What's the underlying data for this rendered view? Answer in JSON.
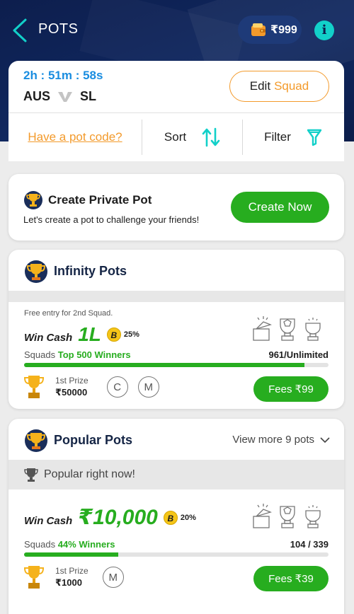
{
  "header": {
    "title": "POTS",
    "wallet_amount": "₹999",
    "info_symbol": "i"
  },
  "match": {
    "timer": "2h : 51m : 58s",
    "team1": "AUS",
    "team2": "SL",
    "edit_label": "Edit",
    "squad_label": "Squad"
  },
  "filters": {
    "pot_code": "Have a pot code?",
    "sort": "Sort",
    "filter": "Filter"
  },
  "private_pot": {
    "title": "Create Private Pot",
    "subtitle": "Let's create a pot to challenge your friends!",
    "button": "Create Now"
  },
  "infinity": {
    "title": "Infinity Pots",
    "free_entry": "Free entry for 2nd Squad.",
    "win_label": "Win Cash",
    "prize": "1L",
    "bonus_letter": "B",
    "bonus_pct": "25%",
    "squads_label": "Squads",
    "winners": "Top 500 Winners",
    "count": "961/Unlimited",
    "progress": 0.92,
    "first_prize_label": "1st Prize",
    "first_prize": "₹50000",
    "badge_c": "C",
    "badge_m": "M",
    "fees": "Fees  ₹99"
  },
  "popular": {
    "title": "Popular Pots",
    "view_more": "View more 9 pots",
    "band": "Popular right now!",
    "win_label": "Win Cash",
    "prize": "₹10,000",
    "bonus_letter": "B",
    "bonus_pct": "20%",
    "squads_label": "Squads",
    "winners": "44% Winners",
    "count": "104 / 339",
    "progress": 0.31,
    "first_prize_label": "1st Prize",
    "first_prize": "₹1000",
    "badge_m": "M",
    "fees": "Fees  ₹39"
  },
  "colors": {
    "accent_green": "#27ad1f",
    "accent_orange": "#f39a2b",
    "header_navy": "#0d1e4d",
    "teal": "#12d0c9"
  }
}
